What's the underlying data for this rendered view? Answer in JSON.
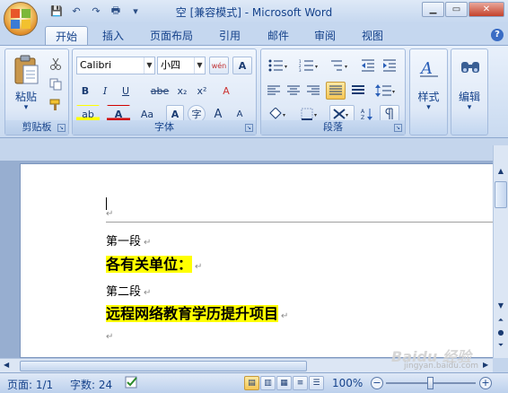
{
  "window": {
    "title": "空 [兼容模式] - Microsoft Word",
    "controls": {
      "minimize": "▁",
      "maximize": "▭",
      "close": "✕"
    }
  },
  "qat": {
    "save": "💾",
    "undo": "↶",
    "redo": "↷",
    "print": "🖶",
    "more": "▾"
  },
  "tabs": [
    {
      "label": "开始",
      "active": true
    },
    {
      "label": "插入"
    },
    {
      "label": "页面布局"
    },
    {
      "label": "引用"
    },
    {
      "label": "邮件"
    },
    {
      "label": "审阅"
    },
    {
      "label": "视图"
    }
  ],
  "help": "?",
  "ribbon": {
    "clipboard": {
      "label": "剪贴板",
      "paste": "粘贴",
      "dd": "▾"
    },
    "font": {
      "label": "字体",
      "font_name": "Calibri",
      "font_size": "小四",
      "bold": "B",
      "italic": "I",
      "underline": "U",
      "strike": "abe",
      "sub": "x₂",
      "sup": "x²",
      "clear": "A",
      "grow": "A",
      "shrink": "A",
      "case": "Aa",
      "char_shade": "A",
      "enclose": "字",
      "highlight": "ab",
      "color": "A",
      "phonetic": "wén",
      "border": "A"
    },
    "paragraph": {
      "label": "段落"
    },
    "styles": {
      "label": "样式"
    },
    "editing": {
      "label": "编辑"
    }
  },
  "document": {
    "paragraphs": [
      {
        "text": "",
        "mark": "↵"
      },
      {
        "text": "第一段",
        "mark": "↵",
        "highlight": false
      },
      {
        "text": "各有关单位：",
        "mark": "↵",
        "highlight": true
      },
      {
        "text": "第二段",
        "mark": "↵",
        "highlight": false
      },
      {
        "text": "远程网络教育学历提升项目",
        "mark": "↵",
        "highlight": true
      },
      {
        "text": "",
        "mark": "↵"
      }
    ]
  },
  "statusbar": {
    "page": "页面: 1/1",
    "words": "字数: 24",
    "zoom": "100%",
    "zoom_minus": "−",
    "zoom_plus": "+"
  },
  "watermark": {
    "brand": "Baidu 经验",
    "url": "jingyan.baidu.com"
  },
  "colors": {
    "highlight": "#ffff00",
    "ribbon_bg": "#dfe9f7",
    "accent": "#15428b"
  }
}
